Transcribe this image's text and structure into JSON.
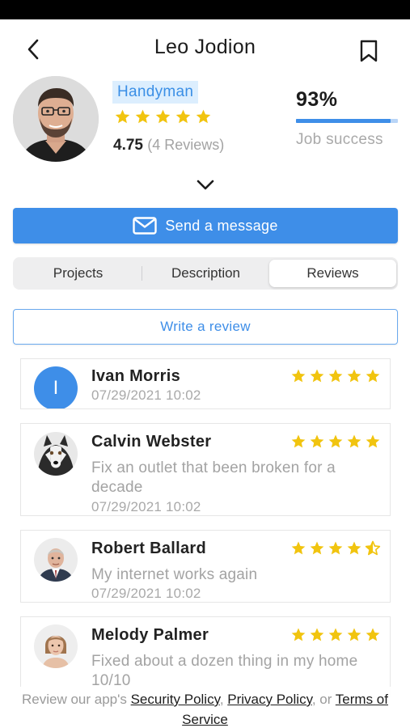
{
  "profile": {
    "name": "Leo Jodion",
    "role": "Handyman",
    "rating": "4.75",
    "rating_stars": 5,
    "reviews_count": "(4 Reviews)",
    "job_success_value": "93%",
    "job_success_fraction": 0.93,
    "job_success_label": "Job success"
  },
  "actions": {
    "send_message": "Send a message",
    "write_review": "Write a review"
  },
  "tabs": [
    {
      "label": "Projects",
      "active": false
    },
    {
      "label": "Description",
      "active": false
    },
    {
      "label": "Reviews",
      "active": true
    }
  ],
  "reviews": [
    {
      "name": "Ivan Morris",
      "initial": "I",
      "text": "",
      "date": "07/29/2021 10:02",
      "stars": 5
    },
    {
      "name": "Calvin Webster",
      "text": "Fix an outlet that been broken for a decade",
      "date": "07/29/2021 10:02",
      "stars": 5
    },
    {
      "name": "Robert Ballard",
      "text": "My internet works again",
      "date": "07/29/2021 10:02",
      "stars": 4.5
    },
    {
      "name": "Melody Palmer",
      "text": "Fixed about a dozen thing in my home 10/10",
      "date": "",
      "stars": 5
    }
  ],
  "footer": {
    "prefix": "Review our app's ",
    "security_policy": "Security Policy",
    "sep1": ", ",
    "privacy_policy": "Privacy Policy",
    "sep2": ", or ",
    "terms": "Terms of Service"
  },
  "colors": {
    "accent": "#3e8ee8",
    "star": "#f1c40f",
    "muted_text": "#a3a3a3",
    "badge_bg": "#dceefe"
  },
  "icons": {
    "back": "chevron-left-icon",
    "bookmark": "bookmark-icon",
    "expand": "chevron-down-icon",
    "mail": "envelope-icon",
    "star": "star-icon"
  }
}
